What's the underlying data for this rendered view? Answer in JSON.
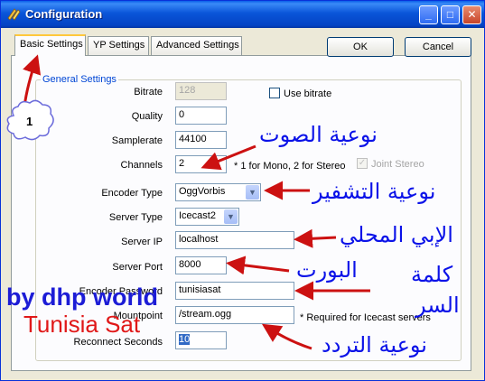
{
  "window": {
    "title": "Configuration"
  },
  "tabs": [
    {
      "label": "Basic Settings",
      "active": true
    },
    {
      "label": "YP Settings",
      "active": false
    },
    {
      "label": "Advanced Settings",
      "active": false
    }
  ],
  "buttons": {
    "ok": "OK",
    "cancel": "Cancel"
  },
  "group": {
    "label": "General Settings"
  },
  "fields": {
    "bitrate": {
      "label": "Bitrate",
      "value": "128"
    },
    "use_bitrate": {
      "label": "Use bitrate",
      "checked": false
    },
    "quality": {
      "label": "Quality",
      "value": "0"
    },
    "samplerate": {
      "label": "Samplerate",
      "value": "44100"
    },
    "channels": {
      "label": "Channels",
      "value": "2",
      "hint": "* 1 for Mono, 2 for Stereo"
    },
    "joint_stereo": {
      "label": "Joint Stereo",
      "checked": true
    },
    "encoder_type": {
      "label": "Encoder Type",
      "value": "OggVorbis"
    },
    "server_type": {
      "label": "Server Type",
      "value": "Icecast2"
    },
    "server_ip": {
      "label": "Server IP",
      "value": "localhost"
    },
    "server_port": {
      "label": "Server Port",
      "value": "8000"
    },
    "encoder_password": {
      "label": "Encoder Password",
      "value": "tunisiasat"
    },
    "mountpoint": {
      "label": "Mountpoint",
      "value": "/stream.ogg",
      "hint": "* Required for Icecast servers"
    },
    "reconnect_seconds": {
      "label": "Reconnect Seconds",
      "value": "10"
    }
  },
  "annotations": {
    "marker_number": "1",
    "arabic": {
      "channels": "نوعية الصوت",
      "encoder": "نوعية التشفير",
      "server_ip": "الإبي المحلي",
      "port": "البورت",
      "password_line1": "كلمة",
      "password_line2": "السر",
      "mountpoint": "نوعية التردد"
    },
    "watermark_line1": "by dhp world",
    "watermark_line2": "Tunisia Sat",
    "arrow_color": "#cc1111",
    "arabic_color": "#0b12e8"
  }
}
